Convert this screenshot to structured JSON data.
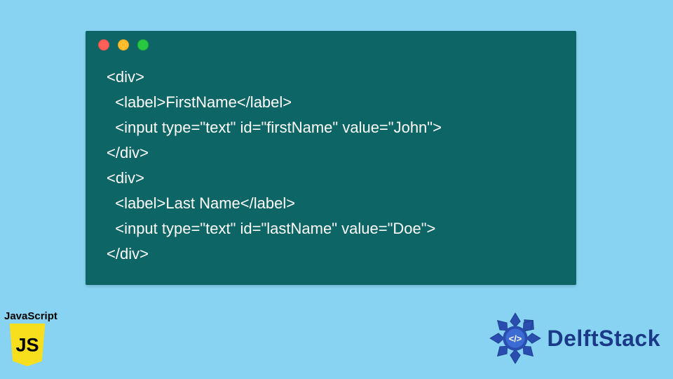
{
  "code": {
    "lines": [
      "<div>",
      "  <label>FirstName</label>",
      "  <input type=\"text\" id=\"firstName\" value=\"John\">",
      "</div>",
      "<div>",
      "  <label>Last Name</label>",
      "  <input type=\"text\" id=\"lastName\" value=\"Doe\">",
      "</div>"
    ]
  },
  "js_badge": {
    "label": "JavaScript",
    "shield_text": "JS"
  },
  "delftstack": {
    "text": "DelftStack"
  },
  "colors": {
    "background": "#87d3f1",
    "window": "#0e6565",
    "js_yellow": "#f7df1e",
    "delft_blue": "#1a3a88"
  }
}
